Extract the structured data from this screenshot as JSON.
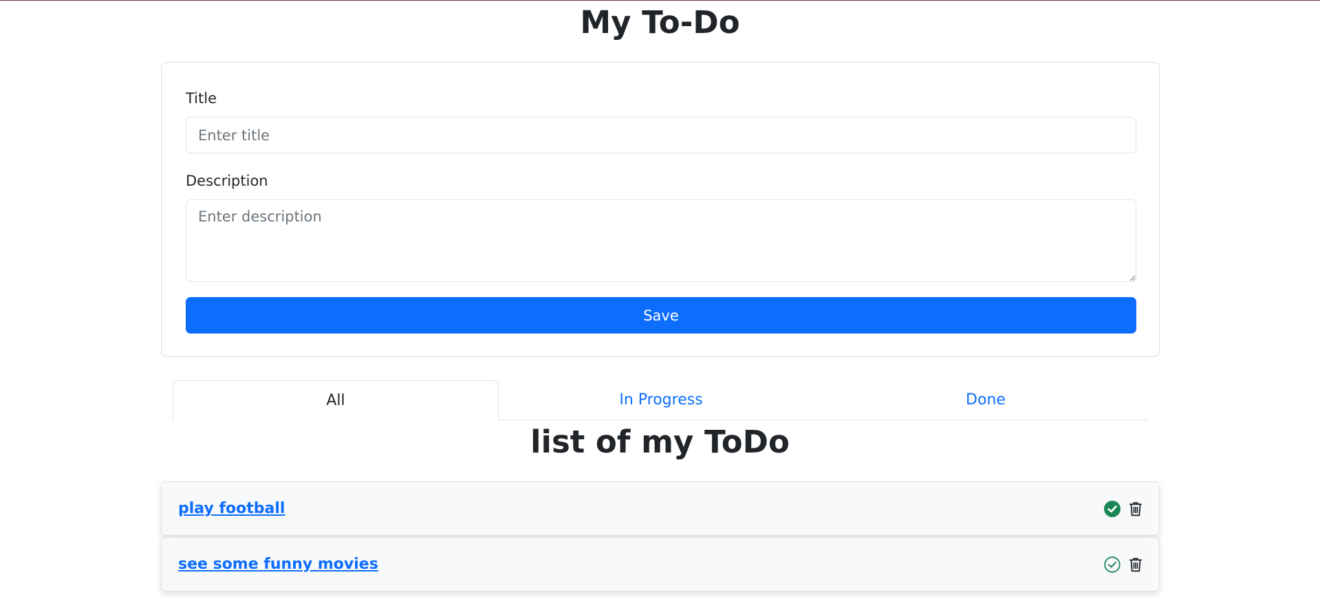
{
  "header": {
    "title": "My To-Do"
  },
  "form": {
    "title_label": "Title",
    "title_placeholder": "Enter title",
    "description_label": "Description",
    "description_placeholder": "Enter description",
    "save_label": "Save"
  },
  "tabs": [
    {
      "label": "All",
      "active": true
    },
    {
      "label": "In Progress",
      "active": false
    },
    {
      "label": "Done",
      "active": false
    }
  ],
  "list": {
    "heading": "list of my ToDo",
    "items": [
      {
        "title": "play football",
        "done": true
      },
      {
        "title": "see some funny movies",
        "done": false
      }
    ]
  },
  "colors": {
    "primary": "#0d6efd",
    "success": "#198754",
    "text": "#212529"
  },
  "icons": {
    "done": "check-circle-fill-icon",
    "not_done": "check-circle-outline-icon",
    "delete": "trash-icon"
  }
}
